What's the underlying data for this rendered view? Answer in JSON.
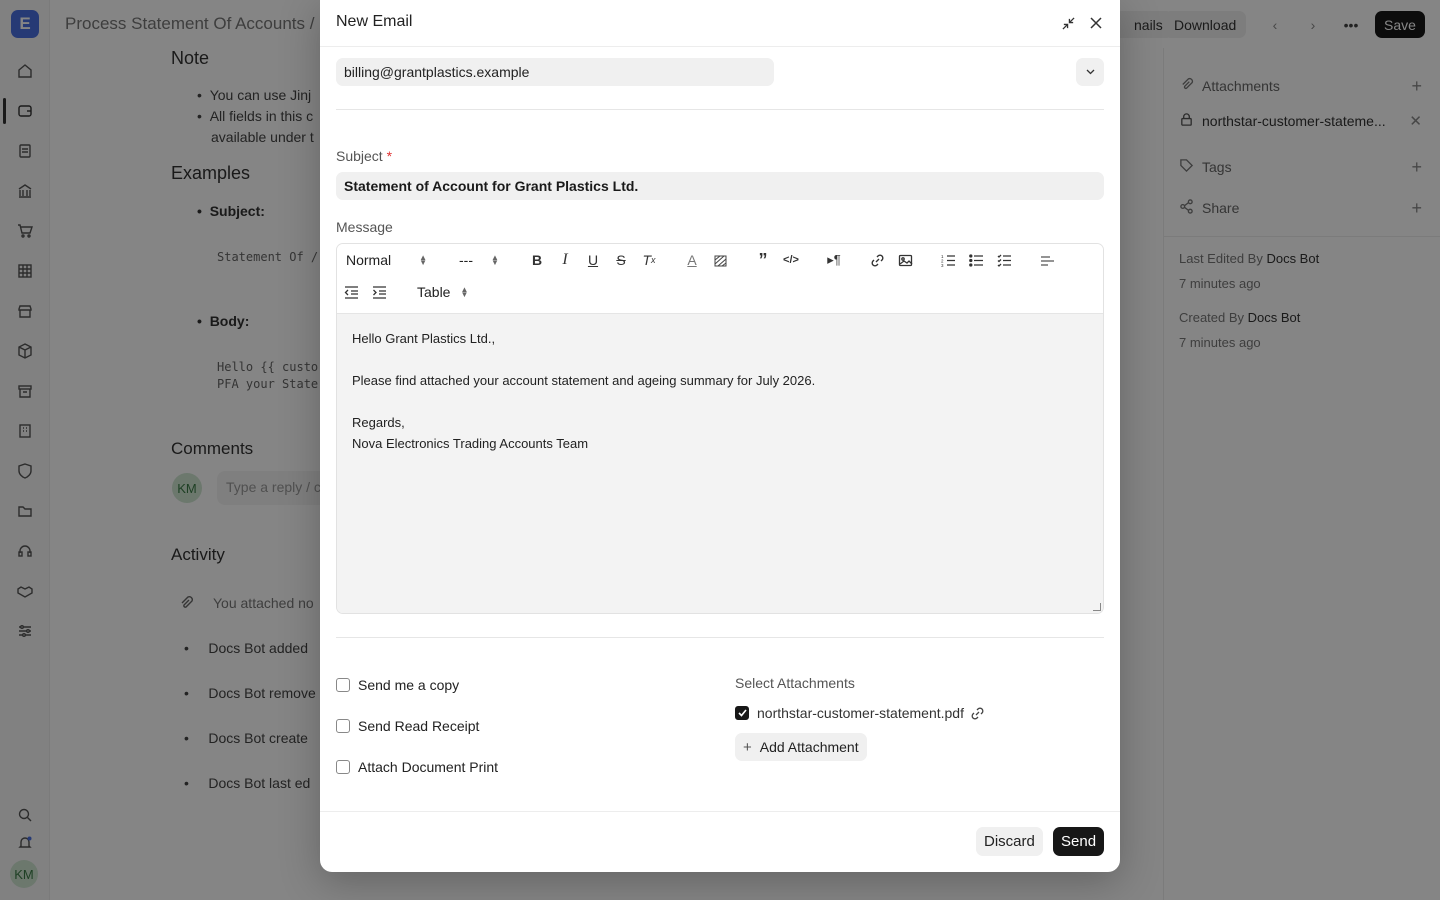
{
  "background": {
    "breadcrumb": "Process Statement Of Accounts  /",
    "topbar": {
      "emails_partial": "nails",
      "download": "Download",
      "save": "Save"
    },
    "note_heading": "Note",
    "note_items": [
      "You can use Jinj",
      "All fields in this c",
      "available under t"
    ],
    "examples_heading": "Examples",
    "examples_subject_label": "Subject:",
    "examples_subject_code": "Statement Of /",
    "examples_body_label": "Body:",
    "examples_body_code": "Hello {{ custo\nPFA your State",
    "comments_heading": "Comments",
    "comment_avatar": "KM",
    "comment_placeholder": "Type a reply / c",
    "activity_heading": "Activity",
    "activity_items": [
      "You attached no",
      "Docs Bot added",
      "Docs Bot remove",
      "Docs Bot create",
      "Docs Bot last ed"
    ],
    "user_avatar": "KM",
    "right_panel": {
      "attachments_label": "Attachments",
      "attachment_file": "northstar-customer-stateme...",
      "tags_label": "Tags",
      "share_label": "Share",
      "last_edited_prefix": "Last Edited By ",
      "last_edited_by": "Docs Bot",
      "last_edited_time": "7 minutes ago",
      "created_prefix": "Created By ",
      "created_by": "Docs Bot",
      "created_time": "7 minutes ago"
    }
  },
  "modal": {
    "title": "New Email",
    "to_value": "billing@grantplastics.example",
    "subject_label": "Subject",
    "subject_required": "*",
    "subject_value": "Statement of Account for Grant Plastics Ltd.",
    "message_label": "Message",
    "toolbar": {
      "paragraph_style": "Normal",
      "font_size": "---",
      "table": "Table"
    },
    "body_lines": [
      "Hello Grant Plastics Ltd.,",
      "",
      "Please find attached your account statement and ageing summary for July 2026.",
      "",
      "Regards,",
      "Nova Electronics Trading Accounts Team"
    ],
    "options": {
      "send_copy": "Send me a copy",
      "read_receipt": "Send Read Receipt",
      "attach_print": "Attach Document Print"
    },
    "attachments": {
      "label": "Select Attachments",
      "file": "northstar-customer-statement.pdf",
      "add_button": "Add Attachment"
    },
    "discard": "Discard",
    "send": "Send"
  },
  "colors": {
    "primary": "#171717",
    "required": "#e03131",
    "logo": "#4a6fe0"
  }
}
